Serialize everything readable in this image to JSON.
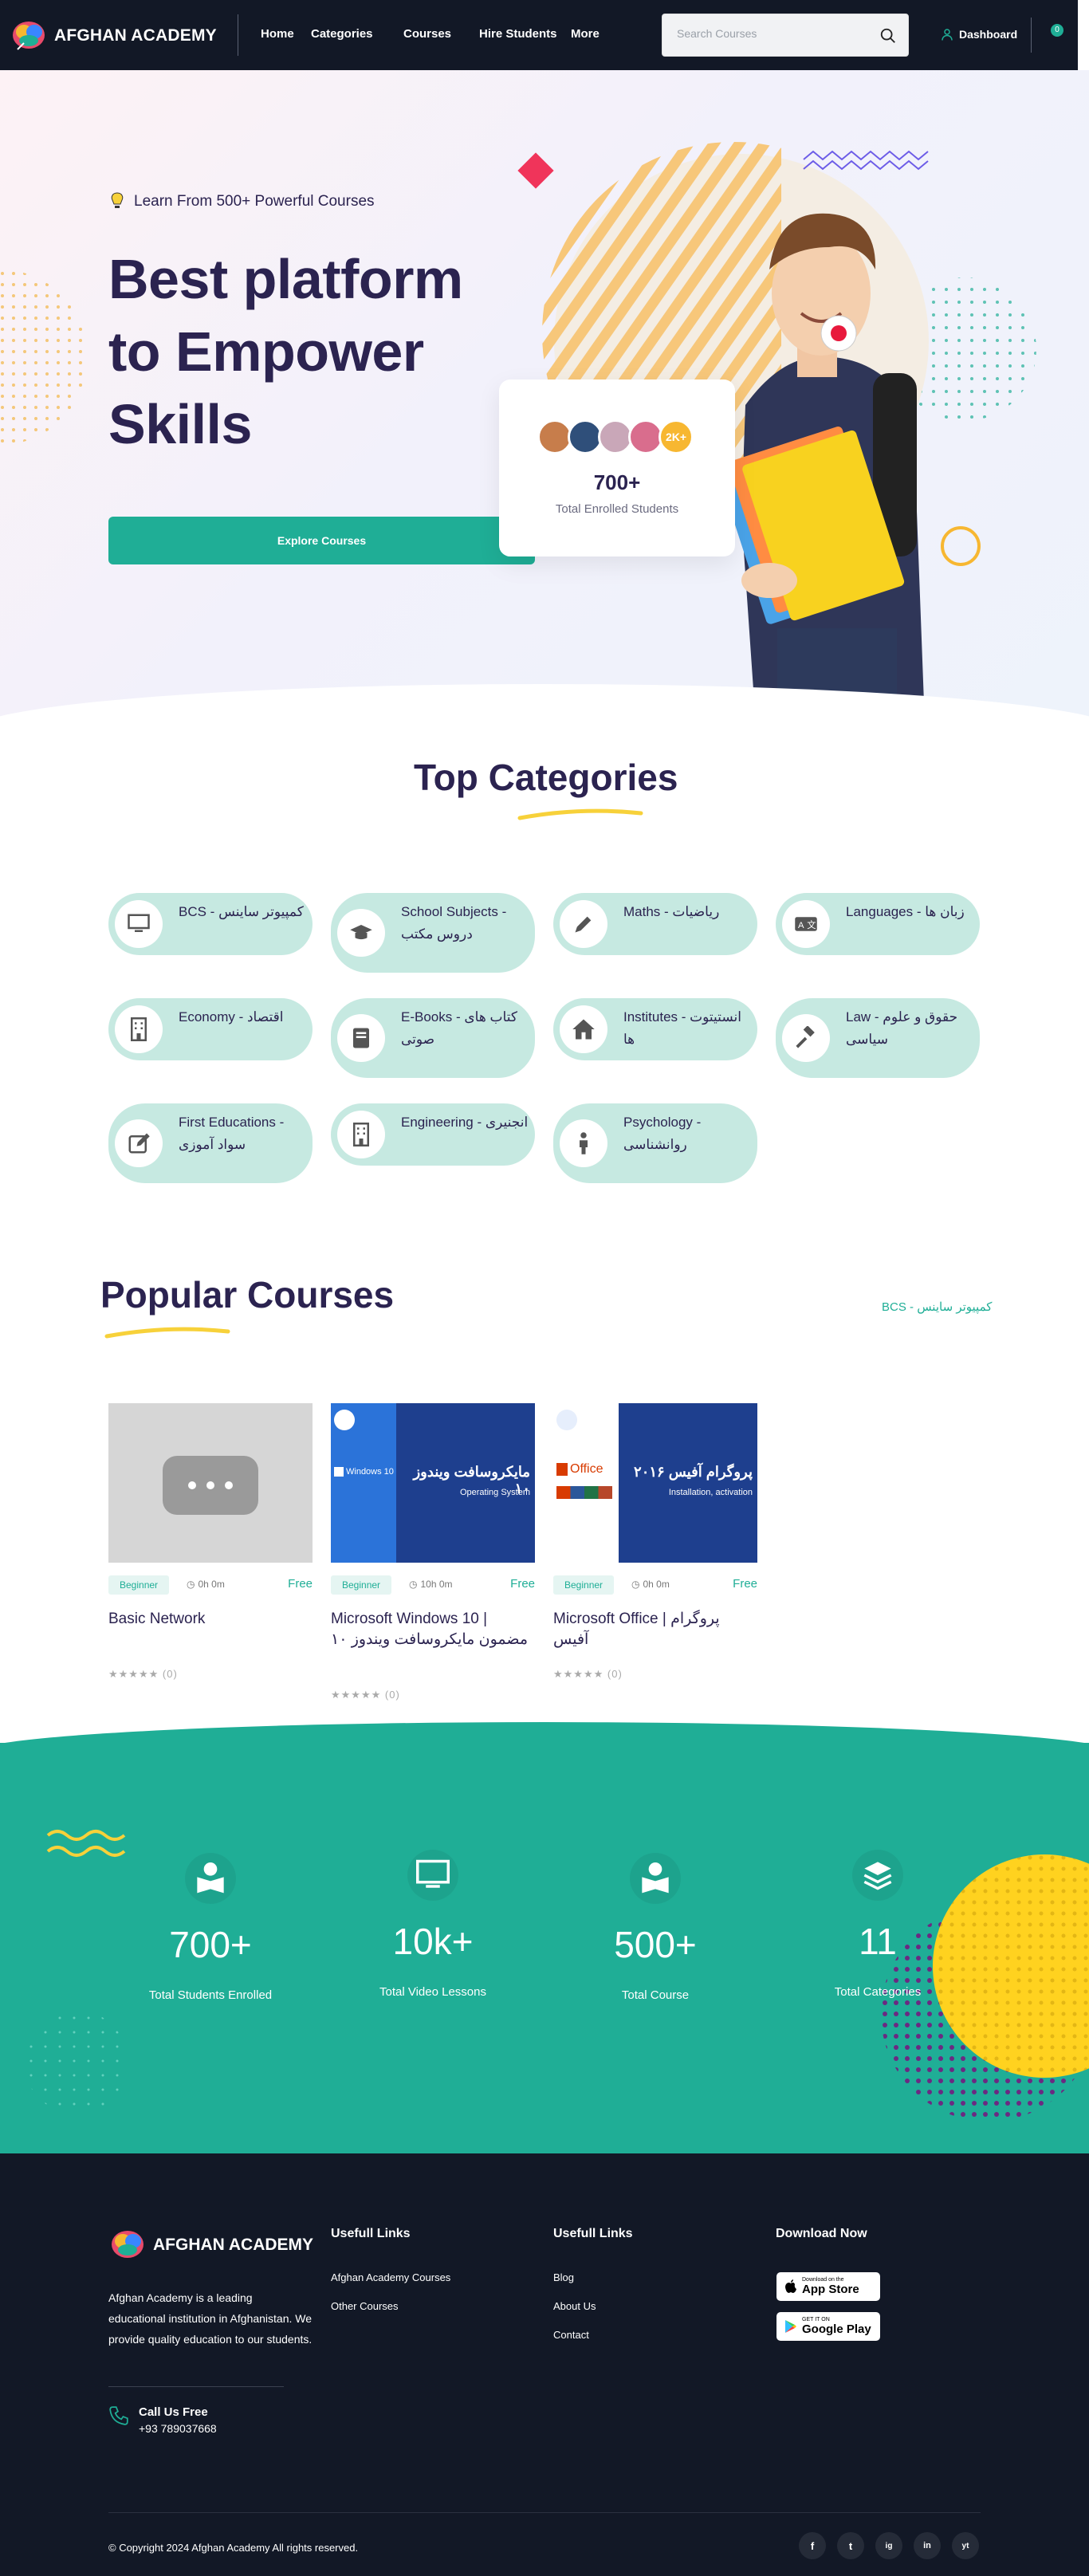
{
  "nav": {
    "brand": "AFGHAN ACADEMY",
    "menu": [
      "Home",
      "Categories",
      "Courses",
      "Hire Students",
      "More"
    ],
    "search_placeholder": "Search Courses",
    "dashboard": "Dashboard",
    "cart_count": "0"
  },
  "hero": {
    "tagline": "Learn From 500+ Powerful Courses",
    "title_lines": [
      "Best platform",
      "to Empower",
      "Skills"
    ],
    "cta": "Explore Courses",
    "enrolled_more": "2K+",
    "enrolled_count": "700+",
    "enrolled_label": "Total Enrolled Students"
  },
  "categories": {
    "title": "Top Categories",
    "items": [
      {
        "label": "BCS - کمپیوتر ساینس",
        "icon": "monitor-icon"
      },
      {
        "label": "School Subjects - دروس مکتب",
        "icon": "graduation-cap-icon"
      },
      {
        "label": "Maths - ریاضیات",
        "icon": "pencil-icon"
      },
      {
        "label": "Languages - زبان ها",
        "icon": "language-icon"
      },
      {
        "label": "Economy - اقتصاد",
        "icon": "building-icon"
      },
      {
        "label": "E-Books - کتاب های صوتی",
        "icon": "book-icon"
      },
      {
        "label": "Institutes - انستیتوت ها",
        "icon": "home-icon"
      },
      {
        "label": "Law - حقوق و علوم سیاسی",
        "icon": "gavel-icon"
      },
      {
        "label": "First Educations - سواد آموزی",
        "icon": "edit-icon"
      },
      {
        "label": "Engineering - انجنیری",
        "icon": "building-icon"
      },
      {
        "label": "Psychology - روانشناسی",
        "icon": "person-icon"
      }
    ]
  },
  "popular": {
    "title": "Popular Courses",
    "filter": "BCS - کمپیوتر ساینس",
    "courses": [
      {
        "level": "Beginner",
        "duration": "0h 0m",
        "price": "Free",
        "title": "Basic Network",
        "reviews": "(0)"
      },
      {
        "level": "Beginner",
        "duration": "10h 0m",
        "price": "Free",
        "title": "Microsoft Windows 10 | مضمون مایکروسافت ویندوز ۱۰",
        "reviews": "(0)",
        "banner": "مایکروسافت ویندوز ۱۰",
        "banner_sub": "Operating System",
        "banner_logo": "Windows 10"
      },
      {
        "level": "Beginner",
        "duration": "0h 0m",
        "price": "Free",
        "title": "Microsoft Office | پروگرام آفیس",
        "reviews": "(0)",
        "banner": "پروگرام آفیس ۲۰۱۶",
        "banner_sub": "Installation, activation",
        "banner_logo": "Office"
      }
    ]
  },
  "stats": [
    {
      "value": "700+",
      "label": "Total Students Enrolled",
      "icon": "reader-icon"
    },
    {
      "value": "10k+",
      "label": "Total Video Lessons",
      "icon": "monitor-icon"
    },
    {
      "value": "500+",
      "label": "Total Course",
      "icon": "reader-icon"
    },
    {
      "value": "11",
      "label": "Total Categories",
      "icon": "layers-icon"
    }
  ],
  "footer": {
    "brand": "AFGHAN ACADEMY",
    "about": "Afghan Academy is a leading educational institution in Afghanistan. We provide quality education to our students.",
    "call_title": "Call Us Free",
    "call_number": "+93 789037668",
    "col1_title": "Usefull Links",
    "col1_links": [
      "Afghan Academy Courses",
      "Other Courses"
    ],
    "col2_title": "Usefull Links",
    "col2_links": [
      "Blog",
      "About Us",
      "Contact"
    ],
    "download_title": "Download Now",
    "appstore_small": "Download on the",
    "appstore_big": "App Store",
    "gplay_small": "GET IT ON",
    "gplay_big": "Google Play",
    "copyright": "© Copyright 2024 Afghan Academy All rights reserved.",
    "social": [
      "f",
      "t",
      "ig",
      "in",
      "yt"
    ]
  },
  "colors": {
    "accent": "#1fae96",
    "dark": "#121826",
    "title": "#2b2350",
    "category_bg": "#c6e9e1"
  }
}
